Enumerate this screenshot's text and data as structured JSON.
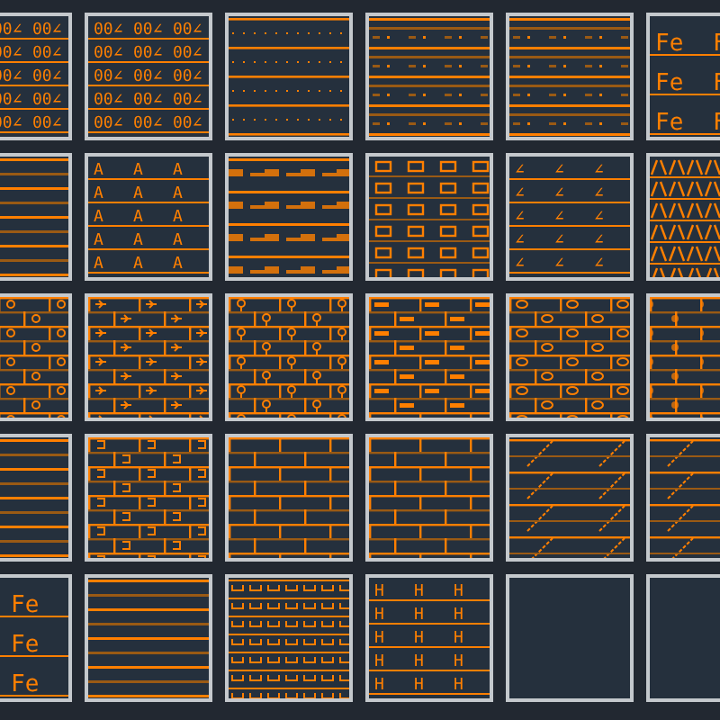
{
  "swatches": [
    {
      "kind": "glyph",
      "glyph": "00∠"
    },
    {
      "kind": "glyph",
      "glyph": "00∠"
    },
    {
      "kind": "dots"
    },
    {
      "kind": "dashdot"
    },
    {
      "kind": "dashdot"
    },
    {
      "kind": "glyph",
      "glyph": "Fe"
    },
    {
      "kind": "lines"
    },
    {
      "kind": "glyph",
      "glyph": "A"
    },
    {
      "kind": "blocks"
    },
    {
      "kind": "rects"
    },
    {
      "kind": "glyph",
      "glyph": "∠"
    },
    {
      "kind": "zigzag"
    },
    {
      "kind": "brick_circle"
    },
    {
      "kind": "brick_arrow"
    },
    {
      "kind": "brick_stem"
    },
    {
      "kind": "brick_bar"
    },
    {
      "kind": "brick_oval"
    },
    {
      "kind": "brick_bead"
    },
    {
      "kind": "lines"
    },
    {
      "kind": "brick_hook"
    },
    {
      "kind": "brick"
    },
    {
      "kind": "brick"
    },
    {
      "kind": "diagonal"
    },
    {
      "kind": "diagonal"
    },
    {
      "kind": "glyph",
      "glyph": "Fe"
    },
    {
      "kind": "lines"
    },
    {
      "kind": "cups"
    },
    {
      "kind": "glyph",
      "glyph": "H"
    },
    {
      "kind": "empty"
    },
    {
      "kind": "empty"
    }
  ]
}
